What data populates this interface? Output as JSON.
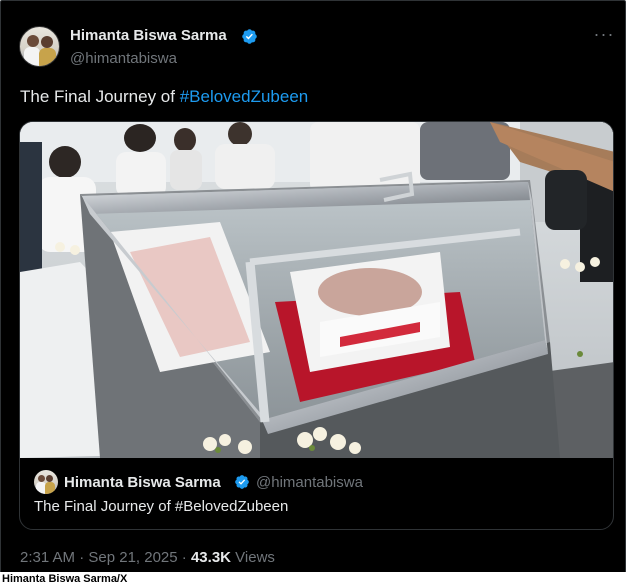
{
  "tweet": {
    "author_name": "Himanta Biswa Sarma",
    "author_handle": "@himantabiswa",
    "more_icon": "more-horizontal-icon",
    "text_prefix": "The Final Journey of ",
    "hashtag": "#BelovedZubeen",
    "timestamp": "2:31 AM · Sep 21, 2025",
    "separator": " · ",
    "views_count": "43.3K",
    "views_label": " Views"
  },
  "quoted": {
    "author_name": "Himanta Biswa Sarma",
    "author_handle": "@himantabiswa",
    "text": "The Final Journey of #BelovedZubeen"
  },
  "colors": {
    "background": "#000000",
    "text_primary": "#e7e9ea",
    "text_secondary": "#71767b",
    "link": "#1d9bf0",
    "verified": "#1d9bf0"
  },
  "credit": "Himanta Biswa Sarma/X"
}
